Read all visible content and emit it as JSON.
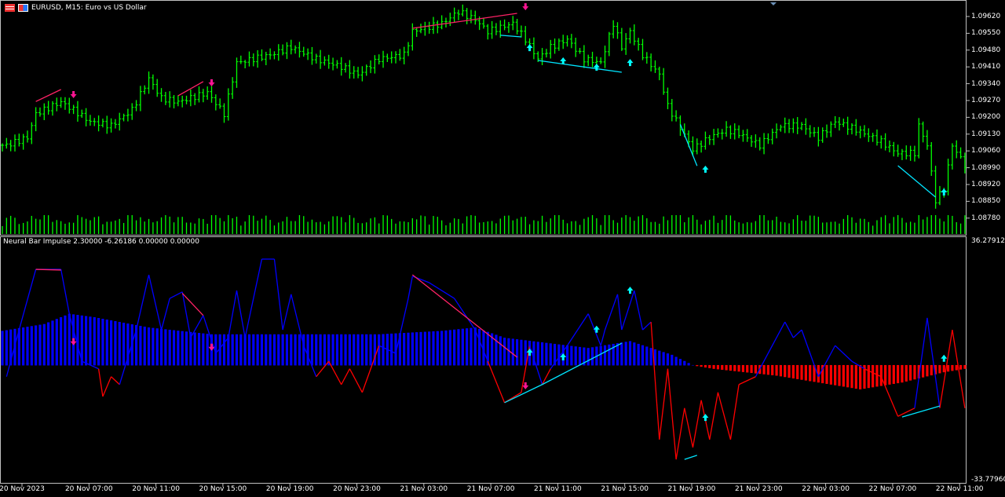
{
  "header": {
    "symbol_title": "EURUSD, M15:  Euro vs US Dollar",
    "icons": [
      "chart-grid-icon",
      "trade-signal-icon"
    ]
  },
  "price_axis": {
    "labels": [
      "1.09620",
      "1.09550",
      "1.09480",
      "1.09410",
      "1.09340",
      "1.09270",
      "1.09200",
      "1.09130",
      "1.09060",
      "1.08990",
      "1.08920",
      "1.08850",
      "1.08780"
    ],
    "top": 1.0962,
    "bottom": 1.0878
  },
  "indicator": {
    "title": "Neural Bar Impulse 2.30000 -6.26186 0.00000 0.00000",
    "axis_max": "36.27912",
    "axis_min": "-33.77960",
    "max": 36.27912,
    "min": -33.7796
  },
  "time_axis": {
    "labels": [
      "20 Nov 2023",
      "20 Nov 07:00",
      "20 Nov 11:00",
      "20 Nov 15:00",
      "20 Nov 19:00",
      "20 Nov 23:00",
      "21 Nov 03:00",
      "21 Nov 07:00",
      "21 Nov 11:00",
      "21 Nov 15:00",
      "21 Nov 19:00",
      "21 Nov 23:00",
      "22 Nov 03:00",
      "22 Nov 07:00",
      "22 Nov 11:00"
    ]
  },
  "colors": {
    "bars": "#00ff00",
    "bull_hist": "#0000ff",
    "bear_hist": "#ff0000",
    "line_up": "#0000ff",
    "line_down": "#ff0000",
    "bull_div": "#00e5ff",
    "bear_div": "#ff2266",
    "sell_arrow": "#ff1493",
    "buy_arrow": "#00ffff",
    "grid": "#c0c0c0"
  },
  "chart_data": {
    "type": "line",
    "bars_count": 231,
    "price_close_anchors": [
      [
        1,
        1.09084
      ],
      [
        6,
        1.09116
      ],
      [
        8,
        1.09215
      ],
      [
        14,
        1.09264
      ],
      [
        17,
        1.09231
      ],
      [
        21,
        1.09182
      ],
      [
        26,
        1.09165
      ],
      [
        31,
        1.09231
      ],
      [
        35,
        1.09362
      ],
      [
        38,
        1.0928
      ],
      [
        42,
        1.09264
      ],
      [
        49,
        1.09303
      ],
      [
        53,
        1.09215
      ],
      [
        56,
        1.09427
      ],
      [
        64,
        1.0946
      ],
      [
        69,
        1.09492
      ],
      [
        75,
        1.09443
      ],
      [
        81,
        1.09411
      ],
      [
        85,
        1.09378
      ],
      [
        90,
        1.09443
      ],
      [
        96,
        1.0946
      ],
      [
        98,
        1.09558
      ],
      [
        105,
        1.09591
      ],
      [
        109,
        1.0964
      ],
      [
        113,
        1.09607
      ],
      [
        116,
        1.09558
      ],
      [
        122,
        1.09591
      ],
      [
        125,
        1.09525
      ],
      [
        128,
        1.09443
      ],
      [
        131,
        1.09492
      ],
      [
        135,
        1.09525
      ],
      [
        139,
        1.09443
      ],
      [
        143,
        1.09427
      ],
      [
        146,
        1.09591
      ],
      [
        148,
        1.09492
      ],
      [
        150,
        1.09558
      ],
      [
        153,
        1.0946
      ],
      [
        157,
        1.09378
      ],
      [
        159,
        1.09247
      ],
      [
        165,
        1.09067
      ],
      [
        169,
        1.09116
      ],
      [
        173,
        1.09149
      ],
      [
        176,
        1.09133
      ],
      [
        181,
        1.09084
      ],
      [
        186,
        1.09165
      ],
      [
        191,
        1.09165
      ],
      [
        195,
        1.09116
      ],
      [
        199,
        1.09182
      ],
      [
        204,
        1.09149
      ],
      [
        210,
        1.09099
      ],
      [
        214,
        1.09051
      ],
      [
        218,
        1.09051
      ],
      [
        219,
        1.09165
      ],
      [
        221,
        1.09084
      ],
      [
        223,
        1.08855
      ],
      [
        225,
        1.08904
      ],
      [
        227,
        1.09084
      ],
      [
        230,
        1.09002
      ]
    ],
    "histogram_anchors": [
      [
        0,
        10
      ],
      [
        10,
        12
      ],
      [
        16,
        15
      ],
      [
        22,
        14
      ],
      [
        35,
        11
      ],
      [
        50,
        9
      ],
      [
        70,
        9
      ],
      [
        90,
        9
      ],
      [
        105,
        10
      ],
      [
        113,
        11
      ],
      [
        120,
        8
      ],
      [
        140,
        5
      ],
      [
        150,
        7
      ],
      [
        160,
        3
      ],
      [
        165,
        0
      ],
      [
        170,
        -1
      ],
      [
        185,
        -3
      ],
      [
        200,
        -6
      ],
      [
        205,
        -7
      ],
      [
        215,
        -5
      ],
      [
        225,
        -2
      ],
      [
        230,
        -1
      ]
    ],
    "oscillator_anchors": [
      [
        1,
        -3.4
      ],
      [
        4,
        10.3
      ],
      [
        8,
        28
      ],
      [
        14,
        28
      ],
      [
        16,
        15
      ],
      [
        19,
        1.1
      ],
      [
        23,
        -1.1
      ],
      [
        24,
        -9.2
      ],
      [
        26,
        -3.4
      ],
      [
        28,
        -5.7
      ],
      [
        32,
        10.3
      ],
      [
        35,
        26.4
      ],
      [
        38,
        10.3
      ],
      [
        40,
        19.5
      ],
      [
        43,
        21.4
      ],
      [
        45,
        8
      ],
      [
        48,
        14.5
      ],
      [
        51,
        3.4
      ],
      [
        54,
        8
      ],
      [
        56,
        21.8
      ],
      [
        58,
        8
      ],
      [
        62,
        31
      ],
      [
        65,
        31
      ],
      [
        67,
        10.3
      ],
      [
        69,
        20.7
      ],
      [
        72,
        5.7
      ],
      [
        75,
        -3.4
      ],
      [
        78,
        1.1
      ],
      [
        81,
        -5.7
      ],
      [
        83,
        -1.1
      ],
      [
        86,
        -8
      ],
      [
        90,
        5.7
      ],
      [
        94,
        3.4
      ],
      [
        97,
        19.5
      ],
      [
        98,
        26
      ],
      [
        102,
        24.1
      ],
      [
        108,
        19.5
      ],
      [
        113,
        10.3
      ],
      [
        116,
        1.1
      ],
      [
        120,
        -11
      ],
      [
        124,
        -8
      ],
      [
        126,
        5.7
      ],
      [
        129,
        -5.7
      ],
      [
        131,
        -1.1
      ],
      [
        135,
        5.7
      ],
      [
        140,
        15
      ],
      [
        143,
        5.7
      ],
      [
        144,
        10.3
      ],
      [
        147,
        20.7
      ],
      [
        148,
        10.3
      ],
      [
        151,
        21.8
      ],
      [
        153,
        10.3
      ],
      [
        155,
        12.6
      ],
      [
        157,
        -21.8
      ],
      [
        159,
        -1.1
      ],
      [
        161,
        -27.6
      ],
      [
        163,
        -12.6
      ],
      [
        165,
        -24.1
      ],
      [
        167,
        -10.3
      ],
      [
        169,
        -21.8
      ],
      [
        171,
        -8
      ],
      [
        174,
        -21.8
      ],
      [
        176,
        -5.7
      ],
      [
        180,
        -3.4
      ],
      [
        187,
        12.6
      ],
      [
        189,
        8
      ],
      [
        191,
        10.3
      ],
      [
        195,
        -3.4
      ],
      [
        199,
        5.7
      ],
      [
        203,
        1.1
      ],
      [
        206,
        -1.1
      ],
      [
        210,
        -3.4
      ],
      [
        214,
        -15
      ],
      [
        218,
        -12.6
      ],
      [
        221,
        13.8
      ],
      [
        224,
        -12.6
      ],
      [
        227,
        10.3
      ],
      [
        230,
        -12.6
      ]
    ],
    "price_sell_arrows": [
      [
        17,
        1.09293
      ],
      [
        50,
        1.09342
      ],
      [
        125,
        1.09659
      ]
    ],
    "price_buy_arrows": [
      [
        126,
        1.09492
      ],
      [
        134,
        1.09437
      ],
      [
        142,
        1.09411
      ],
      [
        150,
        1.0943
      ],
      [
        168,
        1.08986
      ],
      [
        225,
        1.08891
      ]
    ],
    "ind_sell_arrows": [
      [
        17,
        6.7
      ],
      [
        50,
        5.1
      ],
      [
        125,
        -6.2
      ]
    ],
    "ind_buy_arrows": [
      [
        126,
        3.9
      ],
      [
        134,
        2.5
      ],
      [
        142,
        10.6
      ],
      [
        150,
        22
      ],
      [
        168,
        -15.2
      ],
      [
        225,
        2.1
      ]
    ],
    "price_bear_div": [
      [
        [
          8,
          1.09266
        ],
        [
          14,
          1.09316
        ]
      ],
      [
        [
          42,
          1.0929
        ],
        [
          48,
          1.09349
        ]
      ],
      [
        [
          98,
          1.09571
        ],
        [
          123,
          1.09633
        ]
      ]
    ],
    "price_bull_div": [
      [
        [
          119,
          1.09542
        ],
        [
          124,
          1.09535
        ]
      ],
      [
        [
          128,
          1.09437
        ],
        [
          148,
          1.09388
        ]
      ],
      [
        [
          162,
          1.09171
        ],
        [
          166,
          1.08998
        ]
      ],
      [
        [
          214,
          1.08999
        ],
        [
          223,
          1.08868
        ]
      ]
    ],
    "ind_bear_div": [
      [
        [
          8,
          28
        ],
        [
          14,
          27.8
        ]
      ],
      [
        [
          43,
          21
        ],
        [
          48,
          14.5
        ]
      ],
      [
        [
          98,
          26.4
        ],
        [
          123,
          2.3
        ]
      ]
    ],
    "ind_bull_div": [
      [
        [
          120,
          -11
        ],
        [
          129,
          -5.7
        ],
        [
          148,
          6.4
        ]
      ],
      [
        [
          163,
          -27.6
        ],
        [
          166,
          -26.4
        ]
      ],
      [
        [
          215,
          -15.2
        ],
        [
          224,
          -12
        ]
      ]
    ]
  }
}
